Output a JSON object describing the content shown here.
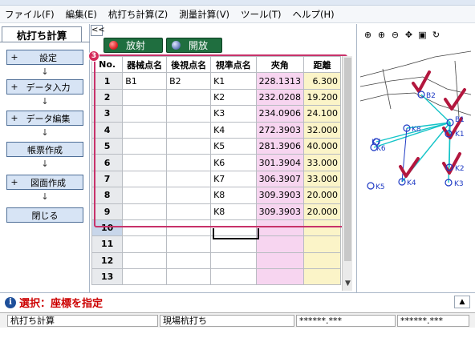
{
  "menu": [
    "ファイル(F)",
    "編集(E)",
    "杭打ち計算(Z)",
    "測量計算(V)",
    "ツール(T)",
    "ヘルプ(H)"
  ],
  "panel": {
    "tab_label": "杭打ち計算",
    "collapse_label": "<<",
    "flow": [
      {
        "label": "設定",
        "plus": "+"
      },
      {
        "label": "データ入力",
        "plus": "+"
      },
      {
        "label": "データ編集",
        "plus": "+"
      },
      {
        "label": "帳票作成",
        "plus": ""
      },
      {
        "label": "図面作成",
        "plus": "+"
      },
      {
        "label": "閉じる",
        "plus": ""
      }
    ],
    "arrow": "↓"
  },
  "toolbar": {
    "radial_label": "放射",
    "open_label": "開放",
    "radial_color": "#e0262a",
    "open_color": "#6f86c4"
  },
  "grid": {
    "badge": "3",
    "headers": [
      "No.",
      "器械点名",
      "後視点名",
      "視準点名",
      "夾角",
      "距離"
    ],
    "rows": [
      {
        "no": "1",
        "ins": "B1",
        "bs": "B2",
        "col": "K1",
        "ang": "228.1313",
        "dist": "6.300"
      },
      {
        "no": "2",
        "ins": "",
        "bs": "",
        "col": "K2",
        "ang": "232.0208",
        "dist": "19.200"
      },
      {
        "no": "3",
        "ins": "",
        "bs": "",
        "col": "K3",
        "ang": "234.0906",
        "dist": "24.100"
      },
      {
        "no": "4",
        "ins": "",
        "bs": "",
        "col": "K4",
        "ang": "272.3903",
        "dist": "32.000"
      },
      {
        "no": "5",
        "ins": "",
        "bs": "",
        "col": "K5",
        "ang": "281.3906",
        "dist": "40.000"
      },
      {
        "no": "6",
        "ins": "",
        "bs": "",
        "col": "K6",
        "ang": "301.3904",
        "dist": "33.000"
      },
      {
        "no": "7",
        "ins": "",
        "bs": "",
        "col": "K7",
        "ang": "306.3907",
        "dist": "33.000"
      },
      {
        "no": "8",
        "ins": "",
        "bs": "",
        "col": "K8",
        "ang": "309.3903",
        "dist": "20.000"
      },
      {
        "no": "9",
        "ins": "",
        "bs": "",
        "col": "K8",
        "ang": "309.3903",
        "dist": "20.000"
      },
      {
        "no": "10",
        "ins": "",
        "bs": "",
        "col": "",
        "ang": "",
        "dist": ""
      },
      {
        "no": "11",
        "ins": "",
        "bs": "",
        "col": "",
        "ang": "",
        "dist": ""
      },
      {
        "no": "12",
        "ins": "",
        "bs": "",
        "col": "",
        "ang": "",
        "dist": ""
      },
      {
        "no": "13",
        "ins": "",
        "bs": "",
        "col": "",
        "ang": "",
        "dist": ""
      }
    ]
  },
  "map": {
    "tools": [
      "zoom-in-icon",
      "zoom-in-icon",
      "zoom-out-icon",
      "pan-icon",
      "fit-icon",
      "refresh-icon"
    ],
    "points": {
      "B1": "B1",
      "B2": "B2",
      "K1": "K1",
      "K2": "K2",
      "K3": "K3",
      "K4": "K4",
      "K5": "K5",
      "K6": "K6",
      "K7": "K7",
      "K8": "K8"
    },
    "point_color": "#1d39c4",
    "line_color": "#14c4c8",
    "check_color": "#b3173e"
  },
  "status": {
    "message": "選択：座標を指定",
    "expand": "▲"
  },
  "statusbar": [
    "杭打ち計算",
    "現場杭打ち",
    "******.***",
    "******.***"
  ]
}
